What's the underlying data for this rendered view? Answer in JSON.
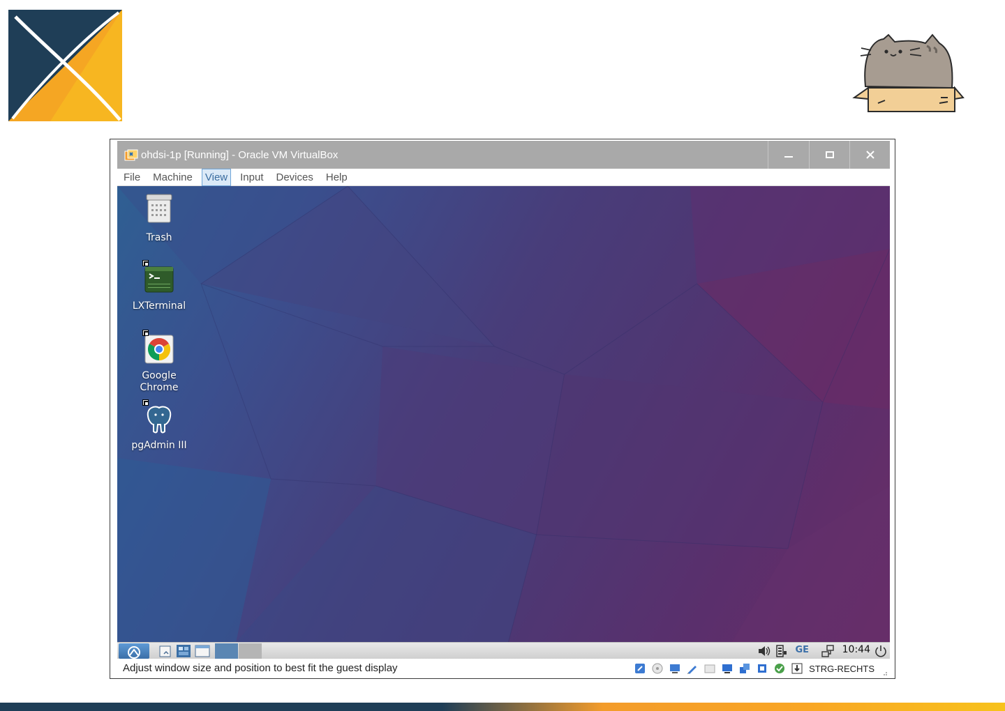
{
  "window": {
    "title": "ohdsi-1p [Running] - Oracle VM VirtualBox",
    "controls": {
      "minimize": "minimize",
      "maximize": "maximize",
      "close": "close"
    }
  },
  "menu": {
    "items": [
      {
        "label": "File"
      },
      {
        "label": "Machine"
      },
      {
        "label": "View",
        "active": true
      },
      {
        "label": "Input"
      },
      {
        "label": "Devices"
      },
      {
        "label": "Help"
      }
    ]
  },
  "desktop": {
    "icons": [
      {
        "label": "Trash",
        "icon": "trash-icon"
      },
      {
        "label": "LXTerminal",
        "icon": "terminal-icon"
      },
      {
        "label": "Google Chrome",
        "icon": "chrome-icon"
      },
      {
        "label": "pgAdmin III",
        "icon": "pgadmin-elephant-icon"
      }
    ]
  },
  "panel": {
    "keyboard_layout": "GE",
    "clock": "10:44"
  },
  "statusbar": {
    "message": "Adjust window size and position to best fit the guest display",
    "host_key": "STRG-RECHTS"
  },
  "colors": {
    "accent_orange": "#f39c2b",
    "navy": "#1f3e57",
    "titlebar": "#a9a9a9",
    "menu_active_bg": "#dbe9f7"
  }
}
